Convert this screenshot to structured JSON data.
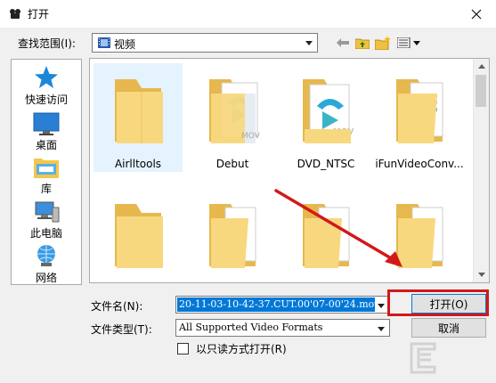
{
  "window": {
    "title": "打开"
  },
  "lookin": {
    "label": "查找范围(I):",
    "value": "视频"
  },
  "places": [
    {
      "label": "快速访问"
    },
    {
      "label": "桌面"
    },
    {
      "label": "库"
    },
    {
      "label": "此电脑"
    },
    {
      "label": "网络"
    }
  ],
  "items": [
    {
      "label": "Airlltools",
      "selected": true
    },
    {
      "label": "Debut",
      "selected": false
    },
    {
      "label": "DVD_NTSC",
      "selected": false
    },
    {
      "label": "iFunVideoConv...",
      "selected": false
    },
    {
      "label": "",
      "selected": false
    },
    {
      "label": "",
      "selected": false
    },
    {
      "label": "",
      "selected": false
    },
    {
      "label": "",
      "selected": false
    }
  ],
  "badges": {
    "mov": "MOV"
  },
  "filename": {
    "label": "文件名(N):",
    "value": "20-11-03-10-42-37.CUT.00'07-00'24.mov"
  },
  "filetype": {
    "label": "文件类型(T):",
    "value": "All Supported Video Formats"
  },
  "buttons": {
    "open": "打开(O)",
    "cancel": "取消"
  },
  "readonly": {
    "label": "以只读方式打开(R)",
    "checked": false
  },
  "colors": {
    "accent": "#0078d7",
    "highlight": "#d21919",
    "folder": "#f6d67a",
    "arrow": "#d21919"
  }
}
